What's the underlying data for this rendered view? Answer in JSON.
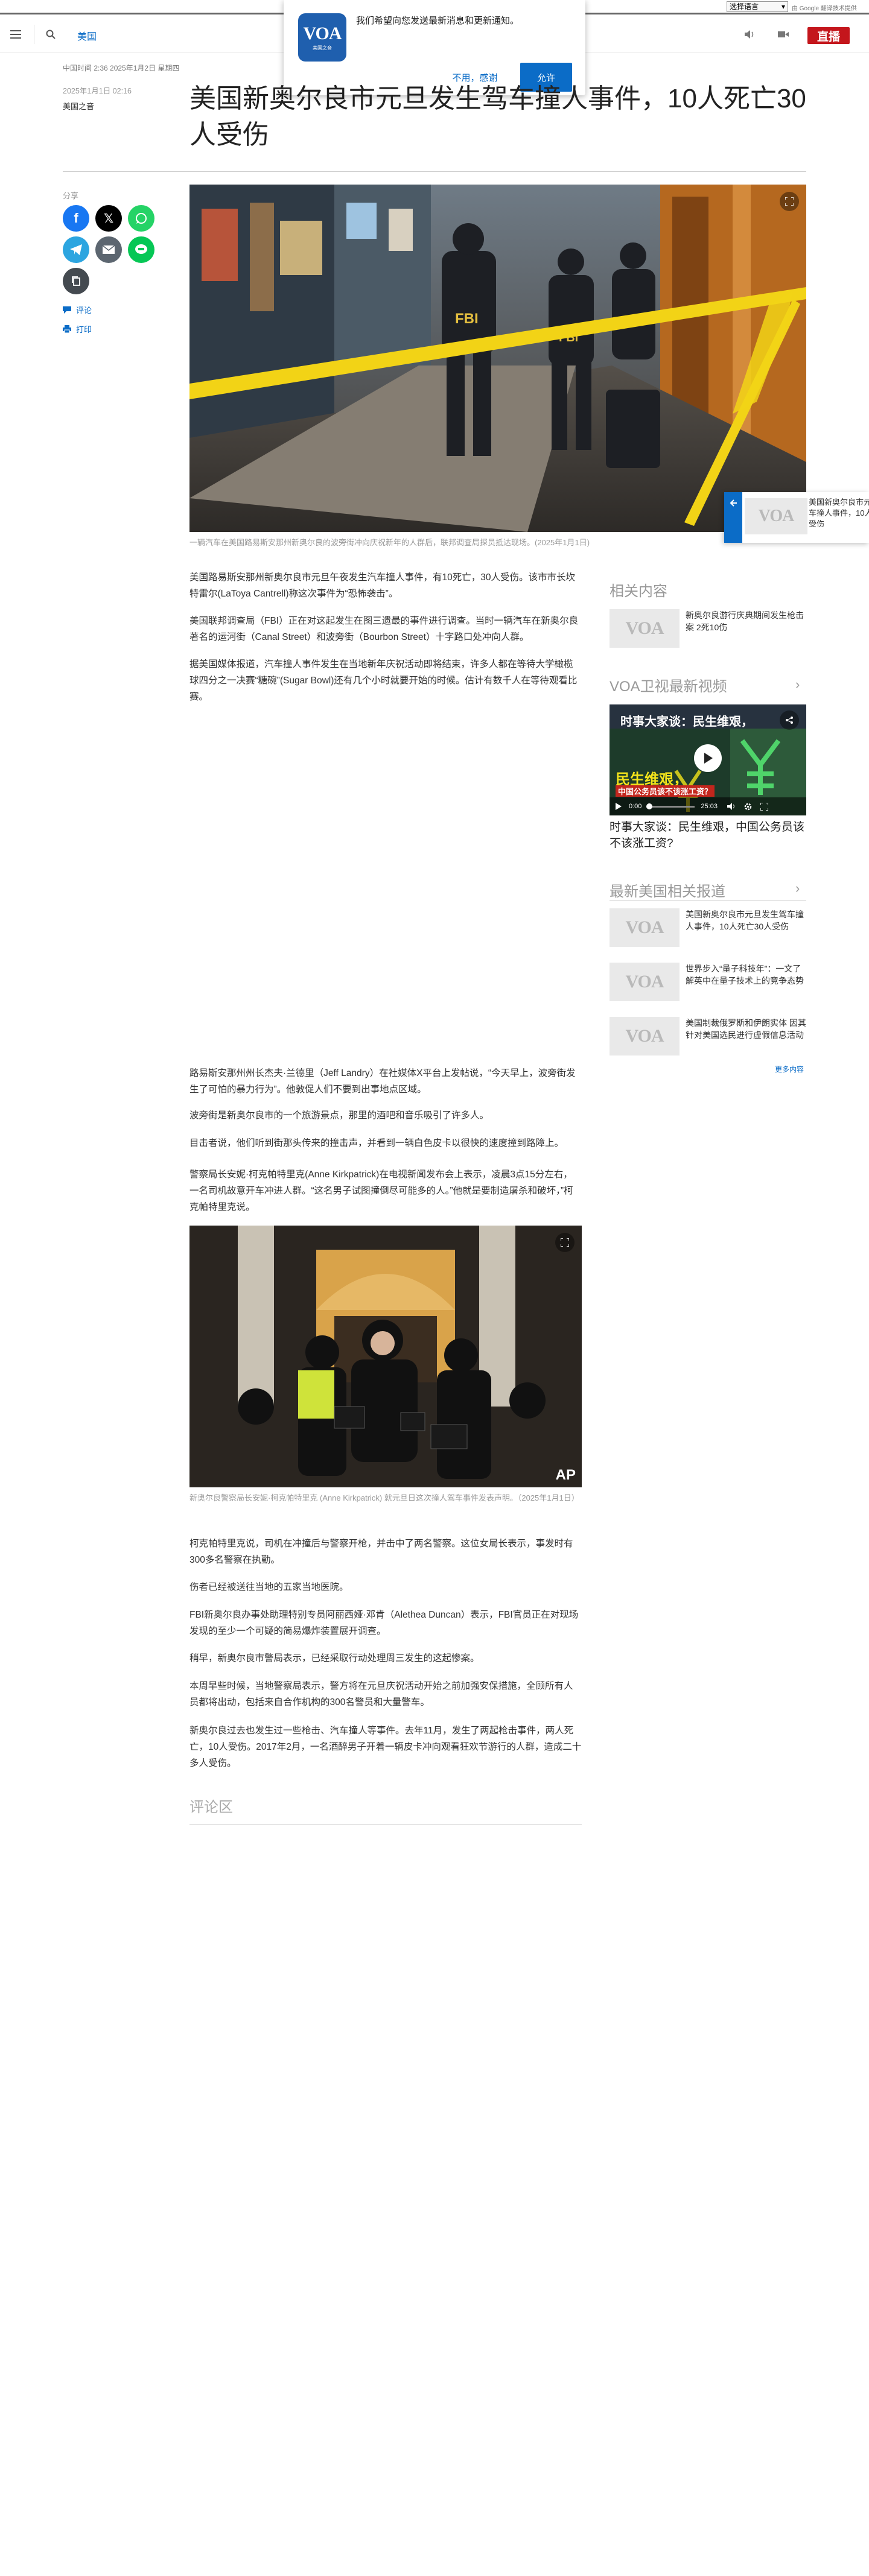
{
  "topbar": {
    "language_select": "选择语言",
    "powered_by": "由 Google 翻译",
    "powered_by_suffix": "技术提供"
  },
  "header": {
    "section": "美国",
    "live_label": "直播"
  },
  "notification": {
    "logo_text": "VOA",
    "logo_sub": "美国之音",
    "message": "我们希望向您发送最新消息和更新通知。",
    "decline": "不用，感谢",
    "allow": "允许"
  },
  "article": {
    "dateline": "中国时间 2:36 2025年1月2日 星期四",
    "date": "2025年1月1日 02:16",
    "byline": "美国之音",
    "title": "美国新奥尔良市元旦发生驾车撞人事件，10人死亡30人受伤",
    "share_label": "分享",
    "comment_label": "评论",
    "print_label": "打印",
    "hero_caption": "一辆汽车在美国路易斯安那州新奥尔良的波旁街冲向庆祝新年的人群后，联邦调查局探员抵达现场。(2025年1月1日)",
    "hero_labels": [
      "FBI",
      "FBI"
    ],
    "paragraphs_a": [
      "美国路易斯安那州新奥尔良市元旦午夜发生汽车撞人事件，有10死亡，30人受伤。该市市长坎特雷尔(LaToya Cantrell)称这次事件为“恐怖袭击”。",
      "美国联邦调查局（FBI）正在对这起发生在图三遗最的事件进行调查。当时一辆汽车在新奥尔良著名的运河街（Canal Street）和波旁街（Bourbon Street）十字路口处冲向人群。",
      "据美国媒体报道，汽车撞人事件发生在当地新年庆祝活动即将结束，许多人都在等待大学橄榄球四分之一决赛“糖碗”(Sugar Bowl)还有几个小时就要开始的时候。估计有数千人在等待观看比赛。"
    ],
    "paragraphs_b": [
      "路易斯安那州州长杰夫·兰德里（Jeff Landry）在社媒体X平台上发帖说，“今天早上，波旁街发生了可怕的暴力行为”。他敦促人们不要到出事地点区域。",
      "波旁街是新奥尔良市的一个旅游景点，那里的酒吧和音乐吸引了许多人。",
      "目击者说，他们听到街那头传来的撞击声，并看到一辆白色皮卡以很快的速度撞到路障上。",
      "警察局长安妮·柯克帕特里克(Anne Kirkpatrick)在电视新闻发布会上表示，凌晨3点15分左右，一名司机故意开车冲进人群。“这名男子试图撞倒尽可能多的人。”他就是要制造屠杀和破坏，”柯克帕特里克说。"
    ],
    "second_caption": "新奥尔良警察局长安妮·柯克帕特里克 (Anne Kirkpatrick) 就元旦日这次撞人驾车事件发表声明。（2025年1月1日）",
    "ap_mark": "AP",
    "paragraphs_c": [
      "柯克帕特里克说，司机在冲撞后与警察开枪，并击中了两名警察。这位女局长表示，事发时有300多名警察在执勤。",
      "伤者已经被送往当地的五家当地医院。",
      "FBI新奥尔良办事处助理特别专员阿丽西娅·邓肯（Alethea Duncan）表示，FBI官员正在对现场发现的至少一个可疑的简易爆炸装置展开调查。",
      "稍早，新奥尔良市警局表示，已经采取行动处理周三发生的这起惨案。",
      "本周早些时候，当地警察局表示，警方将在元旦庆祝活动开始之前加强安保措施，全顾所有人员都将出动，包括来自合作机构的300名警员和大量警车。",
      "新奥尔良过去也发生过一些枪击、汽车撞人等事件。去年11月，发生了两起枪击事件，两人死亡，10人受伤。2017年2月，一名酒醉男子开着一辆皮卡冲向观看狂欢节游行的人群，造成二十多人受伤。"
    ],
    "comments_heading": "评论区"
  },
  "sidebar": {
    "related_heading": "相关内容",
    "related": [
      {
        "text": "新奥尔良游行庆典期间发生枪击案 2死10伤"
      }
    ],
    "video_heading": "VOA卫视最新视频",
    "video": {
      "overlay_title": "时事大家谈：民生维艰，",
      "overlay_big": "民生维艰，",
      "overlay_sub": "中国公务员该不该涨工资？",
      "time_current": "0:00",
      "time_total": "25:03",
      "caption": "时事大家谈：民生维艰，中国公务员该不该涨工资?"
    },
    "latest_heading": "最新美国相关报道",
    "latest": [
      {
        "text": "美国新奥尔良市元旦发生驾车撞人事件，10人死亡30人受伤"
      },
      {
        "text": "世界步入“量子科技年”：一文了解英中在量子技术上的竞争态势"
      },
      {
        "text": "美国制裁俄罗斯和伊朗实体 因其针对美国选民进行虚假信息活动"
      }
    ],
    "more_label": "更多内容"
  },
  "floating": {
    "text": "美国新奥尔良市元旦发生驾车撞人事件，10人死亡30人受伤"
  },
  "colors": {
    "accent": "#0b6cc7",
    "live": "#c4161c",
    "facebook": "#1877f2",
    "x": "#000000",
    "whatsapp": "#25d366",
    "telegram": "#2ca5e0",
    "email": "#5c6670",
    "line": "#06c755",
    "copy": "#444a50"
  }
}
